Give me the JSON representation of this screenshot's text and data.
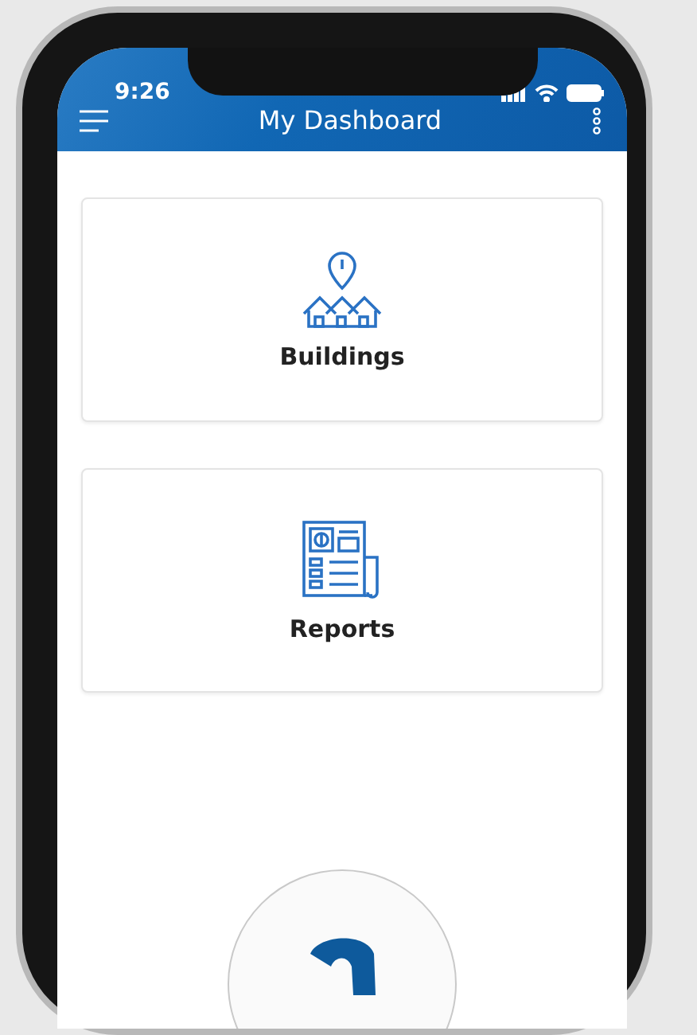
{
  "status_bar": {
    "time": "9:26"
  },
  "app_bar": {
    "title": "My Dashboard"
  },
  "cards": [
    {
      "kind": "buildings",
      "label": "Buildings"
    },
    {
      "kind": "reports",
      "label": "Reports"
    }
  ]
}
